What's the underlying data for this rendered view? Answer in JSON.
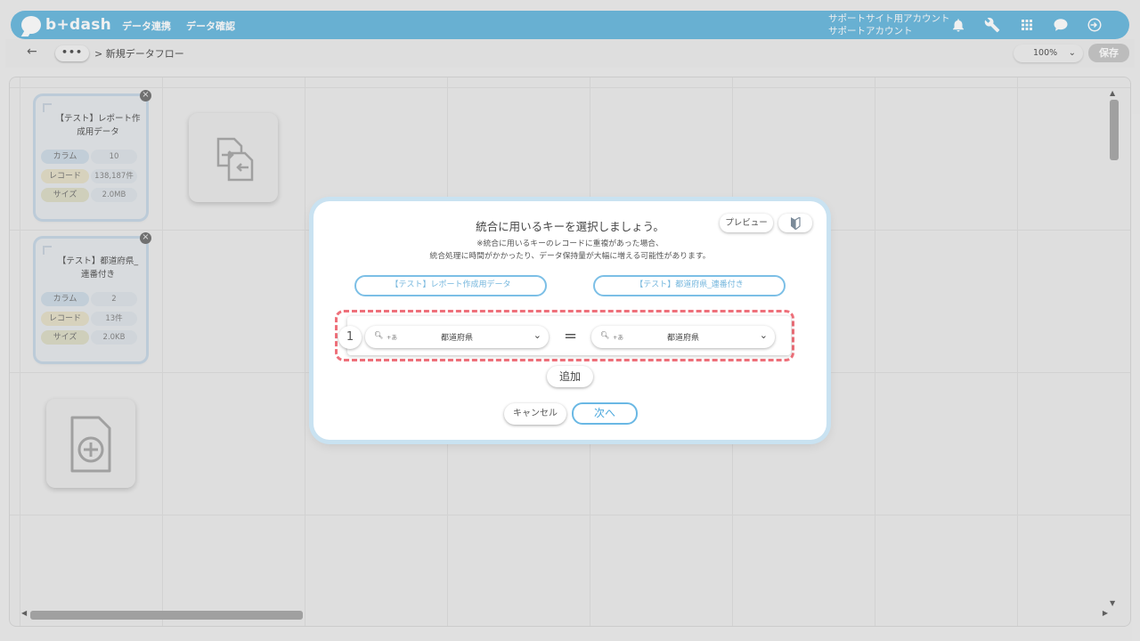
{
  "header": {
    "logo_text": "b+dash",
    "nav": [
      "データ連携",
      "データ確認"
    ],
    "account_line1": "サポートサイト用アカウント",
    "account_line2": "サポートアカウント",
    "icons": [
      "bell-icon",
      "wrench-icon",
      "grid-icon",
      "chat-icon",
      "logout-icon"
    ]
  },
  "breadcrumb": {
    "back": "←",
    "more": "•••",
    "path": "> 新規データフロー"
  },
  "toolbar": {
    "zoom": "100%",
    "save_label": "保存"
  },
  "cards": [
    {
      "title": "【テスト】レポート作成用データ",
      "stats": [
        {
          "label": "カラム",
          "value": "10"
        },
        {
          "label": "レコード",
          "value": "138,187件"
        },
        {
          "label": "サイズ",
          "value": "2.0MB"
        }
      ]
    },
    {
      "title": "【テスト】都道府県_連番付き",
      "stats": [
        {
          "label": "カラム",
          "value": "2"
        },
        {
          "label": "レコード",
          "value": "13件"
        },
        {
          "label": "サイズ",
          "value": "2.0KB"
        }
      ]
    }
  ],
  "modal": {
    "title": "統合に用いるキーを選択しましょう。",
    "note_line1": "※統合に用いるキーのレコードに重複があった場合、",
    "note_line2": "統合処理に時間がかかったり、データ保持量が大幅に増える可能性があります。",
    "preview_label": "プレビュー",
    "left_table": "【テスト】レポート作成用データ",
    "right_table": "【テスト】都道府県_連番付き",
    "key_row": {
      "number": "1",
      "left_value": "都道府県",
      "right_value": "都道府県",
      "type_badge": "+あ",
      "equals": "="
    },
    "add_label": "追加",
    "cancel_label": "キャンセル",
    "next_label": "次へ"
  }
}
